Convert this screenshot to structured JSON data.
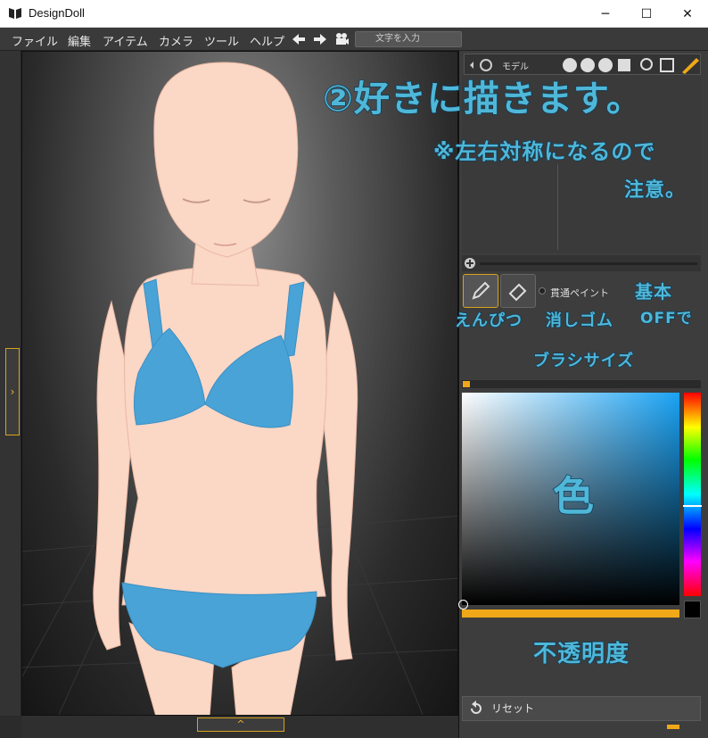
{
  "window": {
    "title": "DesignDoll",
    "minimize": "─",
    "maximize": "☐",
    "close": "✕"
  },
  "menu": [
    "ファイル",
    "編集",
    "アイテム",
    "カメラ",
    "ツール",
    "ヘルプ"
  ],
  "search": {
    "placeholder": "文字を入力"
  },
  "panel": {
    "model_label": "モデル",
    "through_paint_label": "貫通ペイント",
    "reset_label": "リセット"
  },
  "annotations": {
    "step": "②好きに描きます。",
    "note_line1": "※左右対称になるので",
    "note_line2": "注意。",
    "pencil": "えんぴつ",
    "eraser": "消しゴム",
    "basic": "基本",
    "off": "OFFで",
    "brush_size": "ブラシサイズ",
    "color": "色",
    "opacity": "不透明度"
  },
  "colors": {
    "accent": "#f0a818",
    "paint": "#4aa3d6",
    "annotation": "#4fb7d8"
  }
}
